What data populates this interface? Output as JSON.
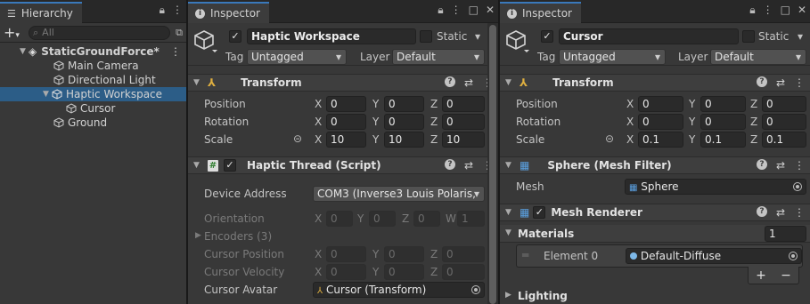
{
  "hierarchy": {
    "tab_label": "Hierarchy",
    "search_placeholder": "All",
    "add_label": "+",
    "scene": "StaticGroundForce*",
    "items": [
      {
        "label": "Main Camera"
      },
      {
        "label": "Directional Light"
      },
      {
        "label": "Haptic Workspace",
        "selected": true
      },
      {
        "label": "Cursor"
      },
      {
        "label": "Ground"
      }
    ]
  },
  "inspector1": {
    "tab_label": "Inspector",
    "object_name": "Haptic Workspace",
    "static_label": "Static",
    "tag_label": "Tag",
    "tag_value": "Untagged",
    "layer_label": "Layer",
    "layer_value": "Default",
    "transform": {
      "title": "Transform",
      "position_label": "Position",
      "position": [
        "0",
        "0",
        "0"
      ],
      "rotation_label": "Rotation",
      "rotation": [
        "0",
        "0",
        "0"
      ],
      "scale_label": "Scale",
      "scale": [
        "10",
        "10",
        "10"
      ]
    },
    "haptic": {
      "title": "Haptic Thread (Script)",
      "device_label": "Device Address",
      "device_value": "COM3 (Inverse3 Louis Polaris, ",
      "orientation_label": "Orientation",
      "orientation": [
        "0",
        "0",
        "0",
        "1"
      ],
      "encoders_label": "Encoders (3)",
      "cursor_pos_label": "Cursor Position",
      "cursor_pos": [
        "0",
        "0",
        "0"
      ],
      "cursor_vel_label": "Cursor Velocity",
      "cursor_vel": [
        "0",
        "0",
        "0"
      ],
      "avatar_label": "Cursor Avatar",
      "avatar_value": "Cursor (Transform)"
    }
  },
  "inspector2": {
    "tab_label": "Inspector",
    "object_name": "Cursor",
    "static_label": "Static",
    "tag_label": "Tag",
    "tag_value": "Untagged",
    "layer_label": "Layer",
    "layer_value": "Default",
    "transform": {
      "title": "Transform",
      "position_label": "Position",
      "position": [
        "0",
        "0",
        "0"
      ],
      "rotation_label": "Rotation",
      "rotation": [
        "0",
        "0",
        "0"
      ],
      "scale_label": "Scale",
      "scale": [
        "0.1",
        "0.1",
        "0.1"
      ]
    },
    "mesh_filter": {
      "title": "Sphere (Mesh Filter)",
      "mesh_label": "Mesh",
      "mesh_value": "Sphere"
    },
    "mesh_renderer": {
      "title": "Mesh Renderer",
      "materials_label": "Materials",
      "materials_count": "1",
      "element_label": "Element 0",
      "element_value": "Default-Diffuse",
      "plus": "+",
      "minus": "−",
      "lighting_label": "Lighting"
    }
  },
  "axes": {
    "x": "X",
    "y": "Y",
    "z": "Z",
    "w": "W"
  },
  "colors": {
    "accent": "#3a79bb",
    "selection": "#2c5d87",
    "panel": "#383838"
  }
}
